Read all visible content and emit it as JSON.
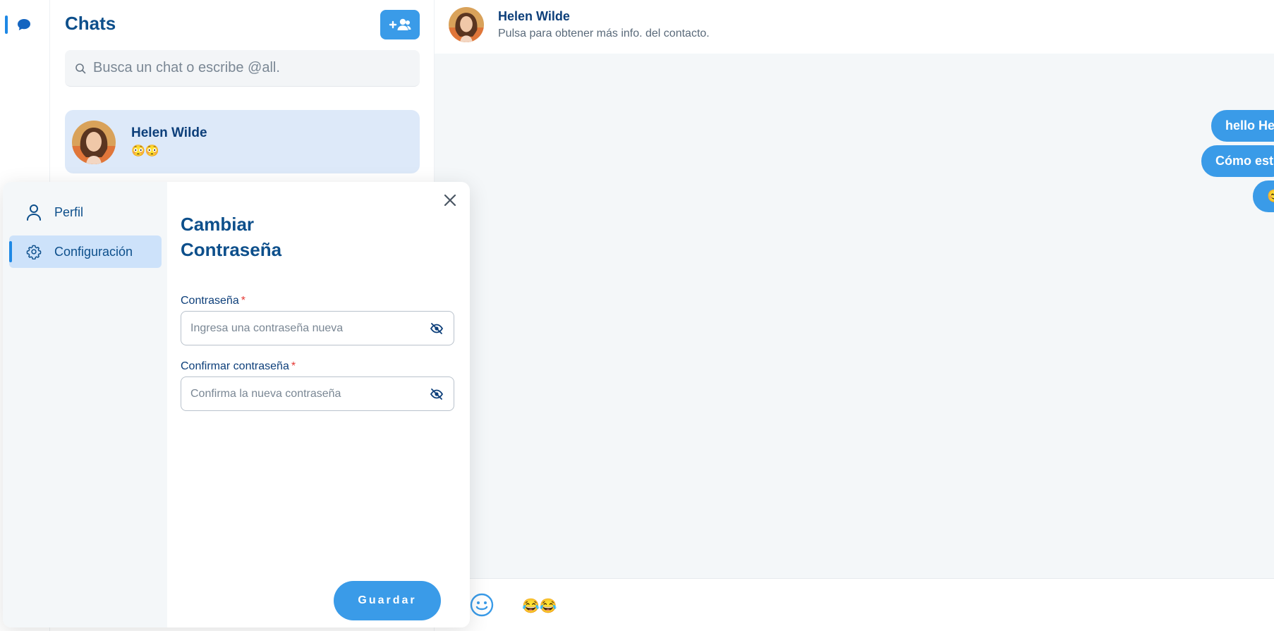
{
  "colors": {
    "accent": "#3a9be8",
    "primary_text": "#0d4f8b",
    "required": "#e53935"
  },
  "chats_panel": {
    "title": "Chats",
    "search": {
      "placeholder": "Busca un chat o escribe @all."
    },
    "items": [
      {
        "name": "Helen Wilde",
        "preview": "😳😳"
      }
    ]
  },
  "conversation": {
    "contact_name": "Helen Wilde",
    "contact_subtitle": "Pulsa para obtener más info. del contacto.",
    "messages": [
      "hello He",
      "Cómo est",
      "😊"
    ],
    "draft": "😂😂"
  },
  "settings_modal": {
    "nav": [
      {
        "label": "Perfil",
        "icon": "user-icon"
      },
      {
        "label": "Configuración",
        "icon": "gear-icon",
        "active": true
      }
    ],
    "title_line1": "Cambiar",
    "title_line2": "Contraseña",
    "fields": [
      {
        "label": "Contraseña",
        "required_mark": "*",
        "placeholder": "Ingresa una contraseña nueva"
      },
      {
        "label": "Confirmar contraseña",
        "required_mark": "*",
        "placeholder": "Confirma la nueva contraseña"
      }
    ],
    "save_label": "Guardar"
  }
}
